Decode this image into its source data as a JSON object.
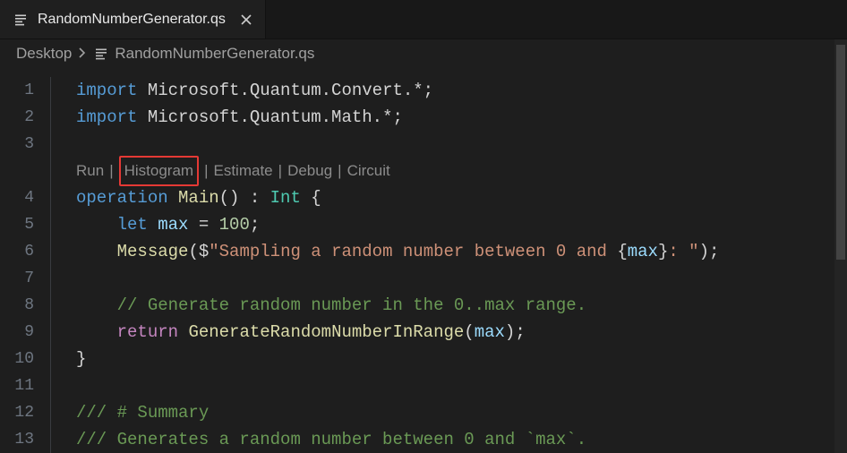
{
  "tab": {
    "filename": "RandomNumberGenerator.qs"
  },
  "breadcrumb": {
    "parent": "Desktop",
    "file": "RandomNumberGenerator.qs"
  },
  "codelens": {
    "run": "Run",
    "histogram": "Histogram",
    "estimate": "Estimate",
    "debug": "Debug",
    "circuit": "Circuit"
  },
  "gutter": [
    "1",
    "2",
    "3",
    "4",
    "5",
    "6",
    "7",
    "8",
    "9",
    "10",
    "11",
    "12",
    "13"
  ],
  "code": {
    "l1": {
      "kw": "import",
      "ns": " Microsoft.Quantum.Convert.*;"
    },
    "l2": {
      "kw": "import",
      "ns": " Microsoft.Quantum.Math.*;"
    },
    "l4": {
      "kw": "operation ",
      "name": "Main",
      "sig1": "() : ",
      "type": "Int",
      "sig2": " {"
    },
    "l5": {
      "let": "let ",
      "var": "max",
      "rest1": " = ",
      "num": "100",
      "rest2": ";"
    },
    "l6": {
      "fn": "Message",
      "p1": "($",
      "str": "\"Sampling a random number between 0 and ",
      "interp1": "{",
      "ivar": "max",
      "interp2": "}",
      "str2": ": \"",
      "p2": ");"
    },
    "l8": {
      "com": "// Generate random number in the 0..max range."
    },
    "l9": {
      "ret": "return ",
      "fn": "GenerateRandomNumberInRange",
      "p1": "(",
      "var": "max",
      "p2": ");"
    },
    "l10": {
      "brace": "}"
    },
    "l12": {
      "com": "/// # Summary"
    },
    "l13": {
      "com": "/// Generates a random number between 0 and `max`."
    }
  }
}
